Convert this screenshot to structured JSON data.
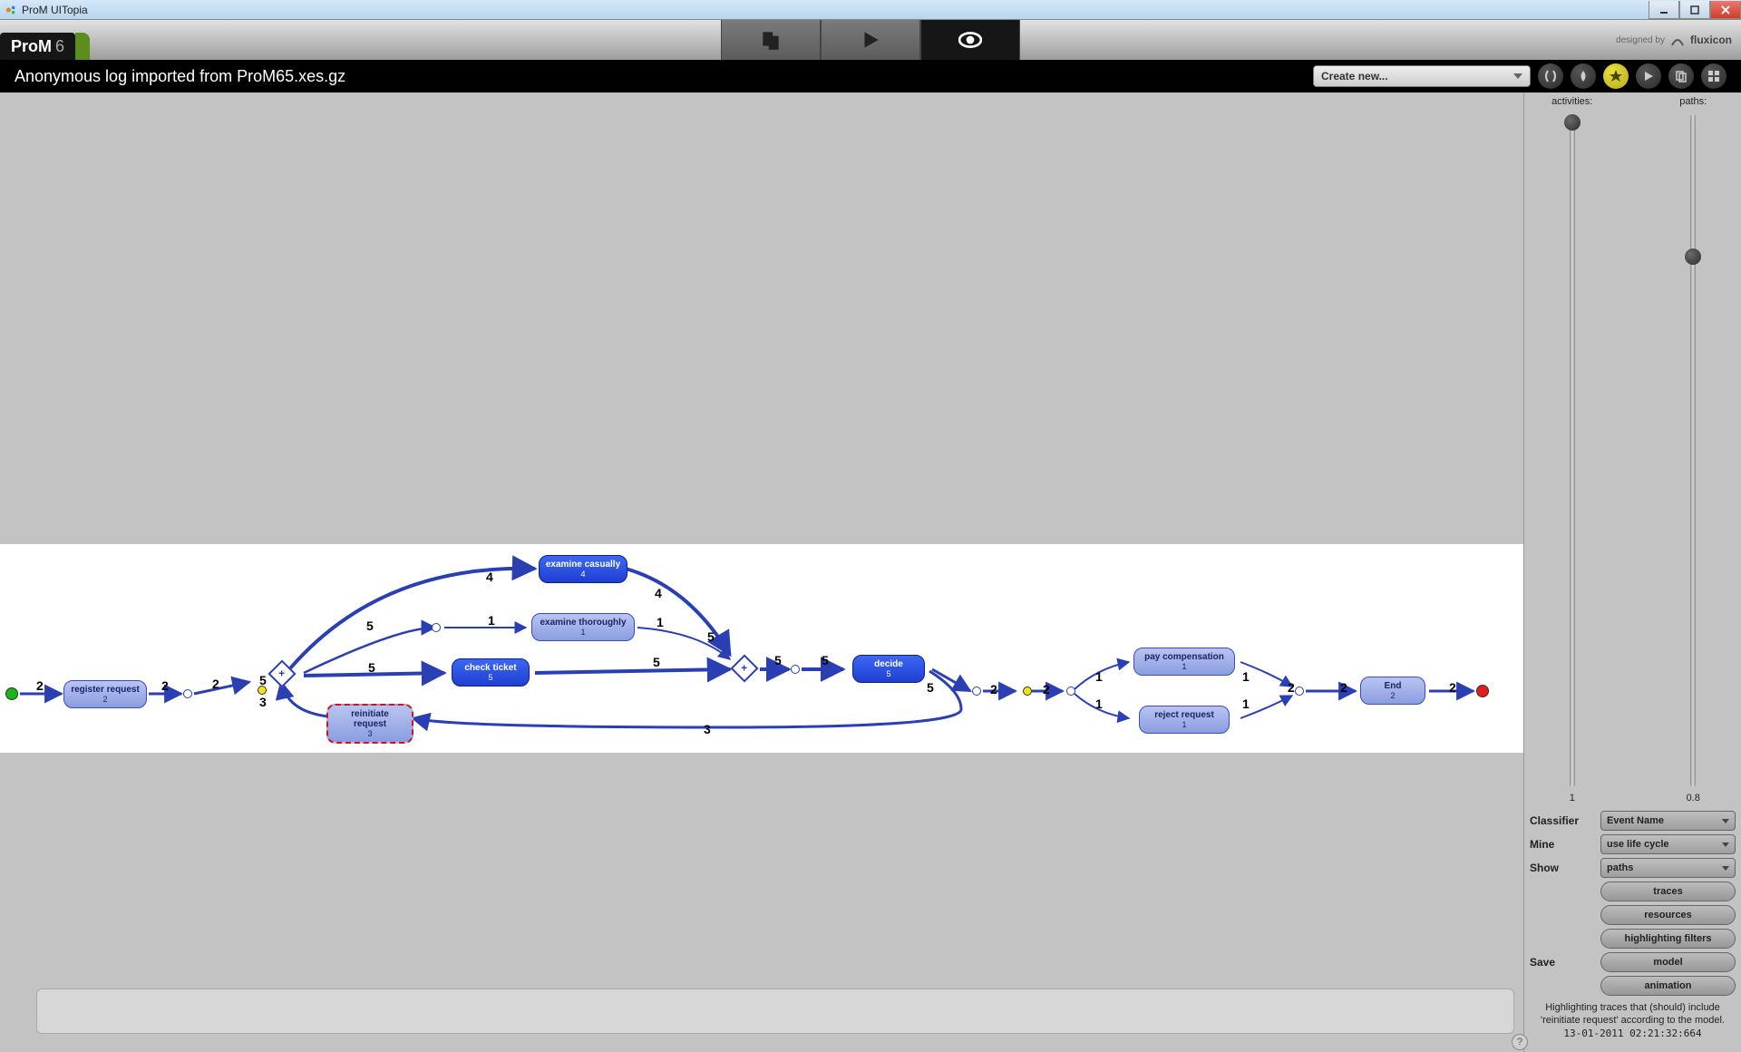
{
  "window": {
    "title": "ProM UITopia"
  },
  "app": {
    "logo_main": "ProM",
    "logo_suffix": "6",
    "designed_by": "designed by",
    "brand": "fluxicon"
  },
  "header": {
    "subtitle": "Anonymous log imported from ProM65.xes.gz",
    "create_label": "Create new..."
  },
  "sliders": {
    "activities": {
      "label": "activities:",
      "value": "1",
      "pos_pct": 0
    },
    "paths": {
      "label": "paths:",
      "value": "0.8",
      "pos_pct": 20
    }
  },
  "controls": {
    "classifier": {
      "label": "Classifier",
      "value": "Event Name"
    },
    "mine": {
      "label": "Mine",
      "value": "use life cycle"
    },
    "show": {
      "label": "Show",
      "value": "paths"
    },
    "btn_traces": "traces",
    "btn_resources": "resources",
    "btn_hfilters": "highlighting filters",
    "save_label": "Save",
    "btn_model": "model",
    "btn_animation": "animation"
  },
  "footer": {
    "hint": "Highlighting traces that (should) include 'reinitiate request' according to the model.",
    "timestamp": "13-01-2011 02:21:32:664"
  },
  "graph": {
    "nodes": {
      "register": {
        "label": "register request",
        "count": "2"
      },
      "reinit": {
        "label": "reinitiate request",
        "count": "3"
      },
      "exam_cas": {
        "label": "examine casually",
        "count": "4"
      },
      "exam_thor": {
        "label": "examine thoroughly",
        "count": "1"
      },
      "check": {
        "label": "check ticket",
        "count": "5"
      },
      "decide": {
        "label": "decide",
        "count": "5"
      },
      "paycomp": {
        "label": "pay compensation",
        "count": "1"
      },
      "reject": {
        "label": "reject request",
        "count": "1"
      },
      "end": {
        "label": "End",
        "count": "2"
      }
    },
    "edge_labels": {
      "e1": "2",
      "e2": "2",
      "e3": "2",
      "e4": "5",
      "e5": "3",
      "e6": "5",
      "e7": "4",
      "e8": "1",
      "e9": "5",
      "e10": "4",
      "e11": "1",
      "e12": "5",
      "e13": "5",
      "e14": "5",
      "e15": "3",
      "e16": "2",
      "e17": "2",
      "e18": "1",
      "e19": "1",
      "e20": "1",
      "e21": "1",
      "e22": "2",
      "e23": "2",
      "e24": "2"
    }
  }
}
